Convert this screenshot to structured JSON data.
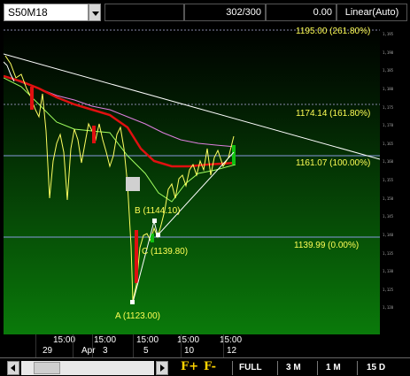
{
  "toolbar": {
    "symbol": "S50M18",
    "bar_count": "302/300",
    "price": "0.00",
    "scale_mode": "Linear(Auto)"
  },
  "fib_labels": [
    {
      "text": "1195.00 (261.80%)"
    },
    {
      "text": "1174.14 (161.80%)"
    },
    {
      "text": "1161.07 (100.00%)"
    },
    {
      "text": "1139.99 (0.00%)"
    }
  ],
  "abc_labels": {
    "a": "A (1123.00)",
    "b": "B (1144.10)",
    "c": "C (1139.80)"
  },
  "y_ticks": [
    "1,195",
    "1,190",
    "1,185",
    "1,180",
    "1,175",
    "1,170",
    "1,165",
    "1,160",
    "1,155",
    "1,150",
    "1,145",
    "1,140",
    "1,135",
    "1,130",
    "1,125",
    "1,120"
  ],
  "time_axis": {
    "top": [
      "15:00",
      "15:00",
      "15:00",
      "15:00",
      "15:00"
    ],
    "bottom": [
      "29",
      "Apr",
      "3",
      "5",
      "10",
      "12"
    ]
  },
  "bottom_bar": {
    "f_plus": "F+",
    "f_minus": "F-",
    "ranges": [
      "FULL",
      "3 M",
      "1 M",
      "15 D"
    ]
  },
  "colors": {
    "background_top": "#000000",
    "background_bottom": "#0a6e0a",
    "fib_label": "#ffff55",
    "abc_label": "#ffff55",
    "ma_red": "#e01010",
    "ma_pink": "#e080e0",
    "ma_green": "#a0ff60",
    "price_line": "#ffff60",
    "trendline": "#ffffff"
  }
}
